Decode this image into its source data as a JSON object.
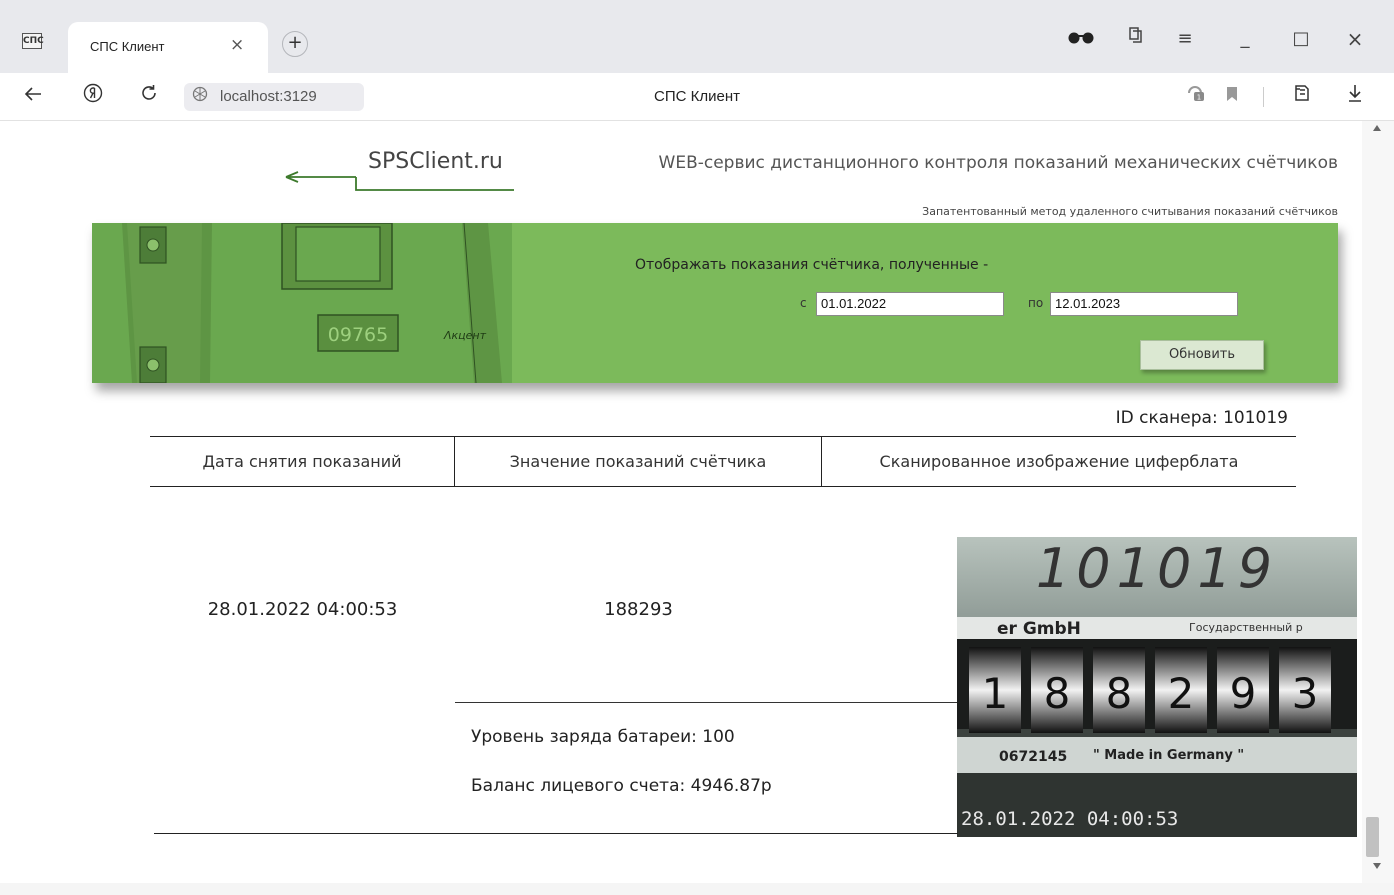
{
  "browser": {
    "tab_title": "СПС Клиент",
    "tab_close": "×",
    "new_tab": "+",
    "app_logo": "СПС",
    "url": "localhost:3129",
    "page_title": "СПС Клиент",
    "window_buttons": {
      "minimize": "_",
      "maximize": "□",
      "close": "×"
    },
    "menu_glyph": "≡"
  },
  "site": {
    "logo_text": "SPSClient.ru",
    "tagline": "WEB-сервис дистанционного контроля показаний механических счётчиков",
    "patent_note": "Запатентованный метод удаленного считывания показаний счётчиков",
    "banner_meter_digits": "09765",
    "banner_meter_brand": "Λкцент"
  },
  "filter": {
    "caption": "Отображать показания счётчика, полученные -",
    "from_label": "с",
    "from_value": "01.01.2022",
    "to_label": "по",
    "to_value": "12.01.2023",
    "refresh_label": "Обновить"
  },
  "scanner": {
    "label": "ID сканера: 101019"
  },
  "table": {
    "headers": [
      "Дата снятия показаний",
      "Значение показаний счётчика",
      "Сканированное изображение циферблата"
    ],
    "rows": [
      {
        "date": "28.01.2022 04:00:53",
        "value": "188293",
        "battery": "Уровень заряда батареи: 100",
        "balance": "Баланс лицевого счета: 4946.87р",
        "photo": {
          "serial": "101019",
          "maker_fragment": "er GmbH",
          "state_fragment": "Государственный р",
          "digits": [
            "1",
            "8",
            "8",
            "2",
            "9",
            "3"
          ],
          "meter_number": "0672145",
          "made_in": "\" Made in Germany \"",
          "timestamp": "28.01.2022 04:00:53"
        }
      }
    ]
  },
  "colors": {
    "banner": "#7cba5b",
    "logo_arrow": "#3d7a2c"
  }
}
